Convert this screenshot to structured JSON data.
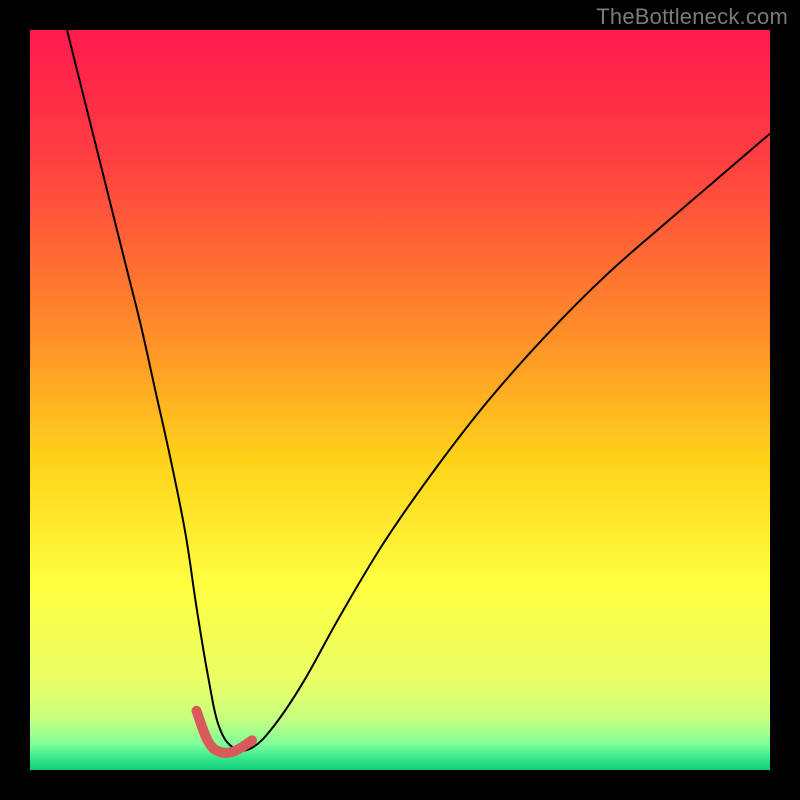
{
  "watermark": "TheBottleneck.com",
  "chart_data": {
    "type": "line",
    "title": "",
    "xlabel": "",
    "ylabel": "",
    "xlim": [
      0,
      100
    ],
    "ylim": [
      0,
      100
    ],
    "gradient_stops": [
      {
        "offset": 0,
        "color": "#ff1a4d"
      },
      {
        "offset": 0.18,
        "color": "#ff4040"
      },
      {
        "offset": 0.4,
        "color": "#ff8a2a"
      },
      {
        "offset": 0.58,
        "color": "#ffd21a"
      },
      {
        "offset": 0.75,
        "color": "#ffff40"
      },
      {
        "offset": 0.88,
        "color": "#eaff66"
      },
      {
        "offset": 0.93,
        "color": "#c8ff80"
      },
      {
        "offset": 0.965,
        "color": "#80ff99"
      },
      {
        "offset": 0.985,
        "color": "#33e68c"
      },
      {
        "offset": 1.0,
        "color": "#14cc7a"
      }
    ],
    "series": [
      {
        "name": "curve",
        "color": "#000000",
        "width": 2,
        "x": [
          5,
          7,
          9,
          11,
          13,
          15,
          17,
          19,
          21,
          22.5,
          24,
          25.5,
          27.5,
          30,
          33,
          37,
          42,
          48,
          55,
          62,
          70,
          78,
          86,
          93,
          100
        ],
        "y": [
          100,
          92,
          84,
          76,
          68,
          60,
          51,
          42,
          32,
          22,
          13,
          6,
          3,
          3,
          6,
          12,
          21,
          31,
          41,
          50,
          59,
          67,
          74,
          80,
          86
        ]
      },
      {
        "name": "highlight-bottom",
        "color": "#d85a5a",
        "width": 10,
        "cap": "round",
        "x": [
          22.5,
          24,
          25.5,
          27.5,
          30
        ],
        "y": [
          8,
          4,
          2.5,
          2.5,
          4
        ]
      }
    ]
  }
}
